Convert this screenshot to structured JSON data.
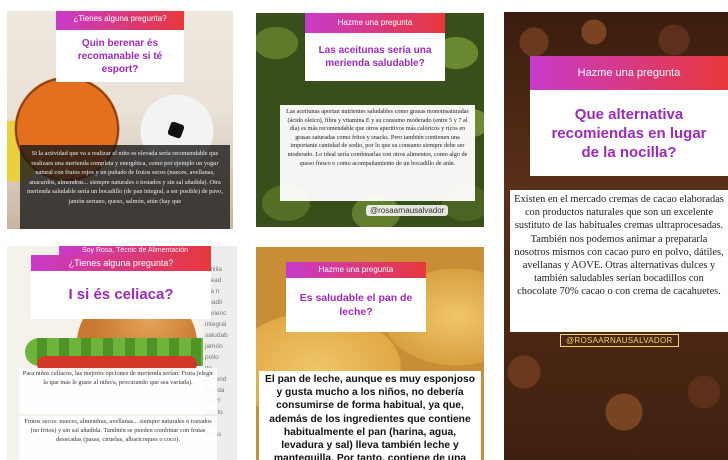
{
  "cards": [
    {
      "header": "¿Tienes alguna pregunta?",
      "question": "Quin berenar és recomanable si té esport?",
      "answer": "Si la actividad que va a realizar el niño es elevada sería recomendable que realizara una merienda completa y energética, como por ejemplo un yogur natural con frutos rojos y un puñado de frutos secos (nueces, avellanas, anacardos, almendras... siempre naturales o tostados y sin sal añadida). Otra merienda saludable sería un bocadillo (de pan integral, a ser posible) de pavo, jamón serrano, queso, salmón, atún (hay que"
    },
    {
      "header": "Hazme una pregunta",
      "question": "Las aceitunas sería una merienda saludable?",
      "answer": "Las aceitunas aportan nutrientes saludables como grasas monoinsaturadas (ácido oleico), fibra y vitamina E y su consumo moderado (entre 5 y 7 al día) es más recomendable que otros aperitivos más calóricos y ricos en grasas saturadas como fritos y snacks. Pero también contienen una importante cantidad de sodio, por lo que su consumo siempre debe ser moderado. Lo ideal sería combinarlas con otros alimentos, como algo de queso fresco o como acompañamiento de un bocadillo de atún.",
      "handle": "@rosaarnausalvador"
    },
    {
      "header": "Hazme una pregunta",
      "question": "Que alternativa recomiendas en lugar de la nocilla?",
      "answer": "Existen en el mercado cremas de cacao elaboradas con productos naturales que son un excelente sustituto de las habituales cremas ultraprocesadas. También nos podemos animar a prepararla nosotros mismos con cacao puro en polvo, dátiles, avellanas y AOVE. Otras alternativas dulces y también saludables serían bocadillos con chocolate 70% cacao o con crema de cacahuetes.",
      "handle": "@ROSAARNAUSALVADOR"
    },
    {
      "banner": "Soy Rosa, Tècnic de Alimentación",
      "header": "¿Tienes alguna pregunta?",
      "question": "I si és celiaca?",
      "answer_1": "Para niños celíacos, las mejores opciones de merienda serían: Fruta (elegir la que más le guste al niño/a, procurando que sea variada).",
      "answer_2": "Frutos secos: nueces, almendras, avellanas... siempre naturales o tostados (no fritos) y sin sal añadida. También se pueden combinar con frutas desecadas (pasas, ciruelas, albaricoques o coco).",
      "side_lines": [
        "emilia",
        "etead",
        "uta n",
        "ocadil",
        "nerienc",
        "integral",
        "saludab",
        "jamón",
        "pollo",
        "ito",
        "almend",
        "ñadida",
        "ción?",
        "ctar lo",
        "sidg",
        "ti viss"
      ]
    },
    {
      "header": "Hazme una pregunta",
      "question": "Es saludable el pan de leche?",
      "answer": "El pan de leche, aunque es muy esponjoso y gusta mucho a los niños, no debería consumirse de forma habitual, ya que, además de los ingredientes que contiene habitualmente el pan (harina, agua, levadura y sal) lleva también leche y mantequilla. Por tanto, contiene de una"
    }
  ],
  "colors": {
    "ig_gradient_start": "#c83bc9",
    "ig_gradient_end": "#e8383b",
    "question_text": "#9b2bb9"
  }
}
